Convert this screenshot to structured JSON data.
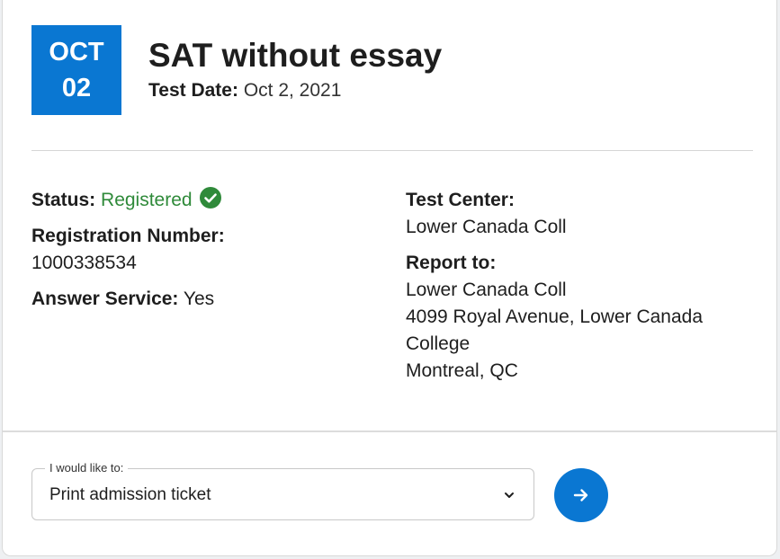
{
  "badge": {
    "month": "OCT",
    "day": "02"
  },
  "test": {
    "title": "SAT without essay",
    "date_label": "Test Date:",
    "date_value": "Oct 2, 2021"
  },
  "details": {
    "status_label": "Status:",
    "status_value": "Registered",
    "registration_label": "Registration Number:",
    "registration_value": "1000338534",
    "answer_label": "Answer Service:",
    "answer_value": "Yes",
    "center_label": "Test Center:",
    "center_value": "Lower Canada Coll",
    "report_label": "Report to:",
    "report_name": "Lower Canada Coll",
    "report_address_line1": "4099 Royal Avenue, Lower Canada",
    "report_address_line2": "College",
    "report_city": "Montreal, QC"
  },
  "action": {
    "legend": "I would like to:",
    "selected": "Print admission ticket",
    "go_icon": "arrow-right-icon"
  },
  "colors": {
    "brand_blue": "#0a77d2",
    "status_green": "#2f8a3a"
  }
}
